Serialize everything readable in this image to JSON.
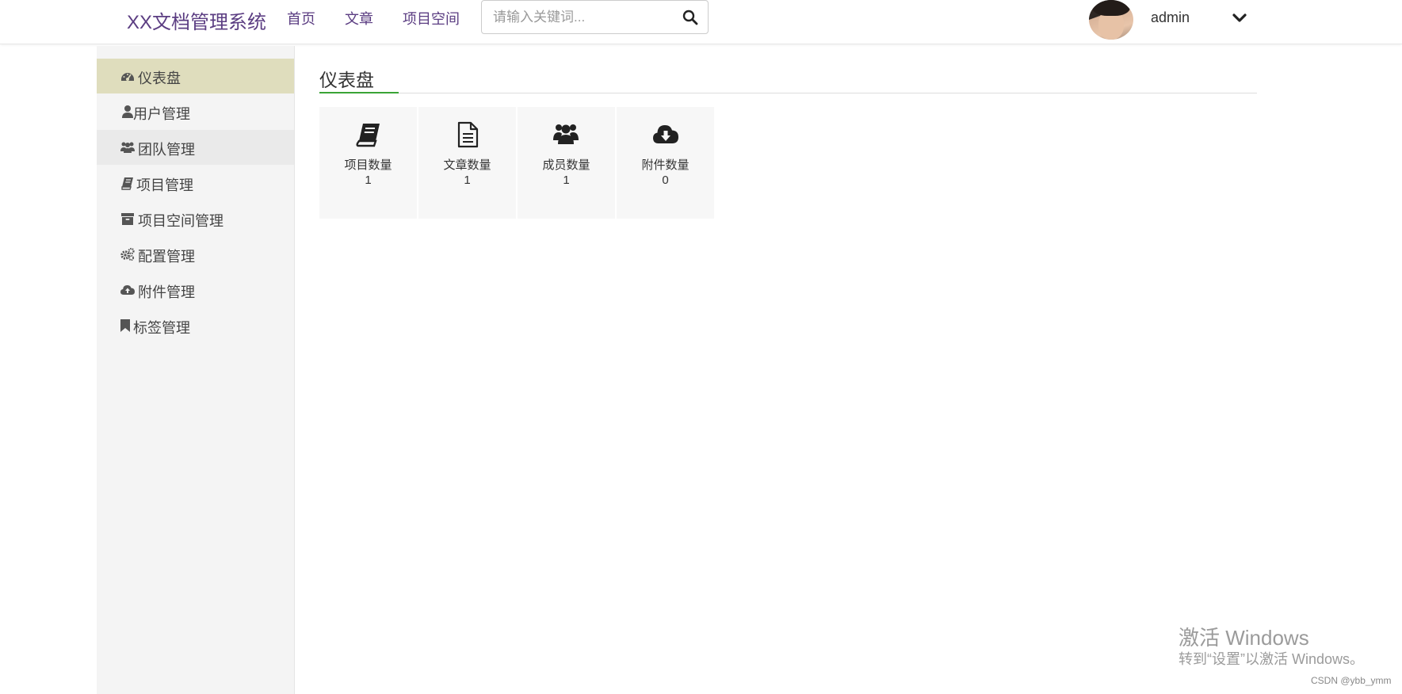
{
  "header": {
    "brand": "XX文档管理系统",
    "nav": {
      "home": "首页",
      "article": "文章",
      "space": "项目空间"
    },
    "search": {
      "placeholder": "请输入关键词...",
      "value": "",
      "icon": "search-icon"
    },
    "user": {
      "name": "admin",
      "avatar": "user-avatar",
      "caret_icon": "chevron-down-icon"
    }
  },
  "sidebar": {
    "items": [
      {
        "label": "仪表盘",
        "icon": "dashboard-icon",
        "state": "active"
      },
      {
        "label": "用户管理",
        "icon": "user-icon",
        "state": "normal"
      },
      {
        "label": "团队管理",
        "icon": "users-icon",
        "state": "hover"
      },
      {
        "label": "项目管理",
        "icon": "book-icon",
        "state": "normal"
      },
      {
        "label": "项目空间管理",
        "icon": "archive-icon",
        "state": "normal"
      },
      {
        "label": "配置管理",
        "icon": "gears-icon",
        "state": "normal"
      },
      {
        "label": "附件管理",
        "icon": "cloud-upload-icon",
        "state": "normal"
      },
      {
        "label": "标签管理",
        "icon": "bookmark-icon",
        "state": "normal"
      }
    ]
  },
  "main": {
    "title": "仪表盘",
    "stats": [
      {
        "label": "项目数量",
        "value": "1",
        "icon": "book-icon"
      },
      {
        "label": "文章数量",
        "value": "1",
        "icon": "file-text-icon"
      },
      {
        "label": "成员数量",
        "value": "1",
        "icon": "users-icon"
      },
      {
        "label": "附件数量",
        "value": "0",
        "icon": "cloud-download-icon"
      }
    ]
  },
  "watermark": {
    "title": "激活 Windows",
    "subtitle": "转到“设置”以激活 Windows。",
    "credit": "CSDN @ybb_ymm"
  },
  "colors": {
    "brand": "#5b3d82",
    "active_menu": "#dfddbd",
    "accent_rule": "#3aa336",
    "sidebar_bg": "#f4f4f4"
  }
}
